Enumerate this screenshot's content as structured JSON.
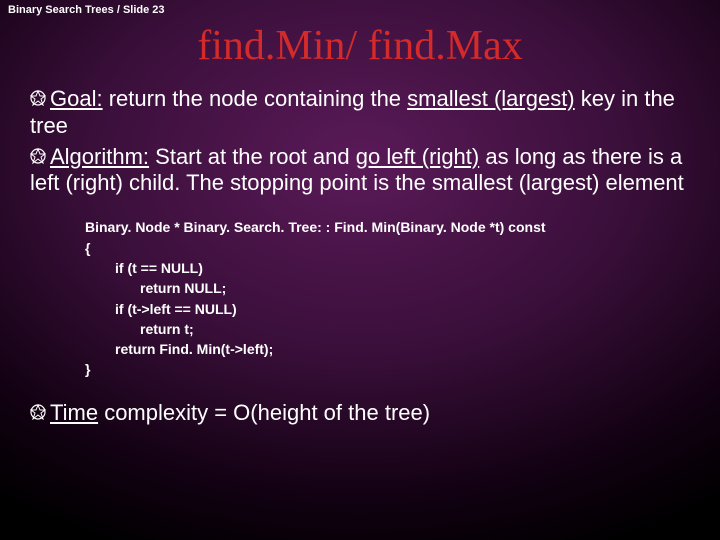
{
  "header": "Binary Search Trees / Slide 23",
  "title": "find.Min/ find.Max",
  "bullets": {
    "b1": {
      "lead": "Goal:",
      "rest": " return the node containing the ",
      "ul1": "smallest (largest)",
      "rest2": " key in the tree"
    },
    "b2": {
      "lead": "Algorithm:",
      "rest": " Start at the root and ",
      "ul1": "go left (right)",
      "rest2": " as long as there is a left (right) child. The stopping point is the smallest (largest) element"
    },
    "b3": {
      "lead": "Time",
      "rest": " complexity = O(height of the tree)"
    }
  },
  "code": {
    "l1": "Binary. Node * Binary. Search. Tree: : Find. Min(Binary. Node *t) const",
    "l2": "{",
    "l3": "if (t == NULL)",
    "l4": "return NULL;",
    "l5": "if (t->left == NULL)",
    "l6": "return t;",
    "l7": "return Find. Min(t->left);",
    "l8": "}"
  }
}
